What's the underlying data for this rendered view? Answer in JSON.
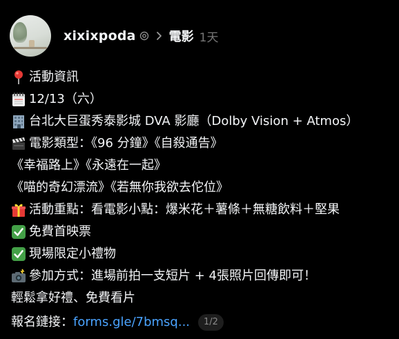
{
  "post": {
    "author": {
      "username": "xixixpoda",
      "verified_icon": "threads-badge-icon",
      "avatar": "avatar"
    },
    "separator_icon": "chevron-right-icon",
    "topic": "電影",
    "time": "1天"
  },
  "content": {
    "line1": {
      "icon": "round-pushpin",
      "text": "活動資訊"
    },
    "line2": {
      "icon": "spiral-calendar",
      "text": "12/13（六）"
    },
    "line3": {
      "icon": "office-building",
      "text": "台北大巨蛋秀泰影城 DVA 影廳（Dolby Vision + Atmos）"
    },
    "line4": {
      "icon": "clapper-board",
      "text": "電影類型：《96 分鐘》《自殺通告》"
    },
    "line5": {
      "text": "《幸福路上》《永遠在一起》"
    },
    "line6": {
      "text": "《喵的奇幻漂流》《若無你我欲去佗位》"
    },
    "line7": {
      "icon": "wrapped-gift",
      "text": "活動重點：看電影小點：爆米花＋薯條＋無糖飲料＋堅果"
    },
    "line8": {
      "icon": "check-mark-button",
      "text": "免費首映票"
    },
    "line9": {
      "icon": "check-mark-button",
      "text": "現場限定小禮物"
    },
    "line10": {
      "icon": "camera-with-flash",
      "text": "參加方式：進場前拍一支短片 + 4張照片回傳即可！"
    },
    "line11": {
      "text": "輕鬆拿好禮、免費看片"
    },
    "line12": {
      "label": "報名鏈接：",
      "link_text": "forms.gle/7bmsq...",
      "pager": "1/2"
    }
  },
  "colors": {
    "background": "#000000",
    "text": "#f3f5f7",
    "muted": "#777777",
    "link": "#4aa3ff"
  }
}
